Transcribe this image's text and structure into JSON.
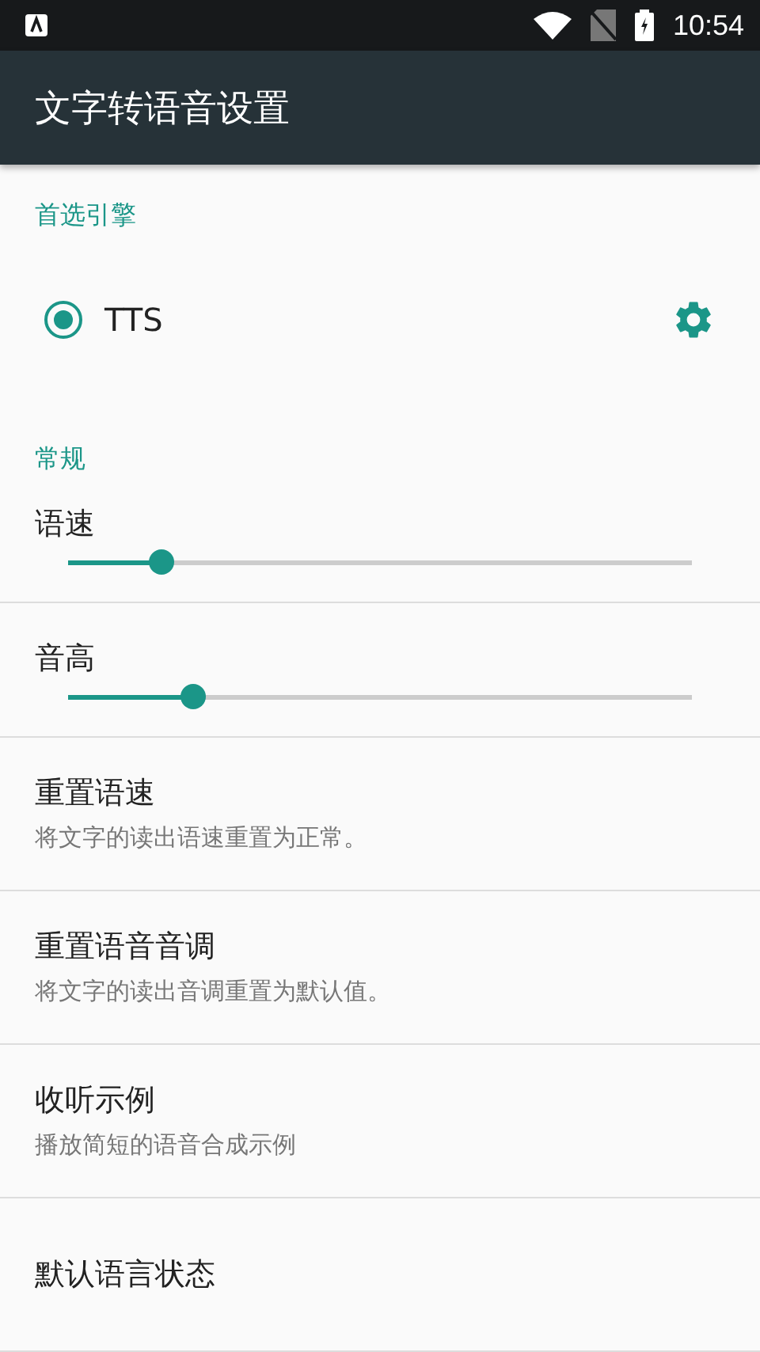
{
  "status_bar": {
    "time": "10:54"
  },
  "app_bar": {
    "title": "文字转语音设置"
  },
  "sections": [
    {
      "header": "首选引擎",
      "items": [
        {
          "kind": "engine",
          "label": "TTS",
          "selected": true
        }
      ]
    },
    {
      "header": "常规",
      "items": [
        {
          "kind": "slider",
          "label": "语速",
          "level": 0.15
        },
        {
          "kind": "slider",
          "label": "音高",
          "level": 0.2
        },
        {
          "kind": "text",
          "title": "重置语速",
          "summary": "将文字的读出语速重置为正常。"
        },
        {
          "kind": "text",
          "title": "重置语音音调",
          "summary": "将文字的读出音调重置为默认值。"
        },
        {
          "kind": "text",
          "title": "收听示例",
          "summary": "播放简短的语音合成示例"
        },
        {
          "kind": "text",
          "title": "默认语言状态"
        }
      ]
    }
  ]
}
